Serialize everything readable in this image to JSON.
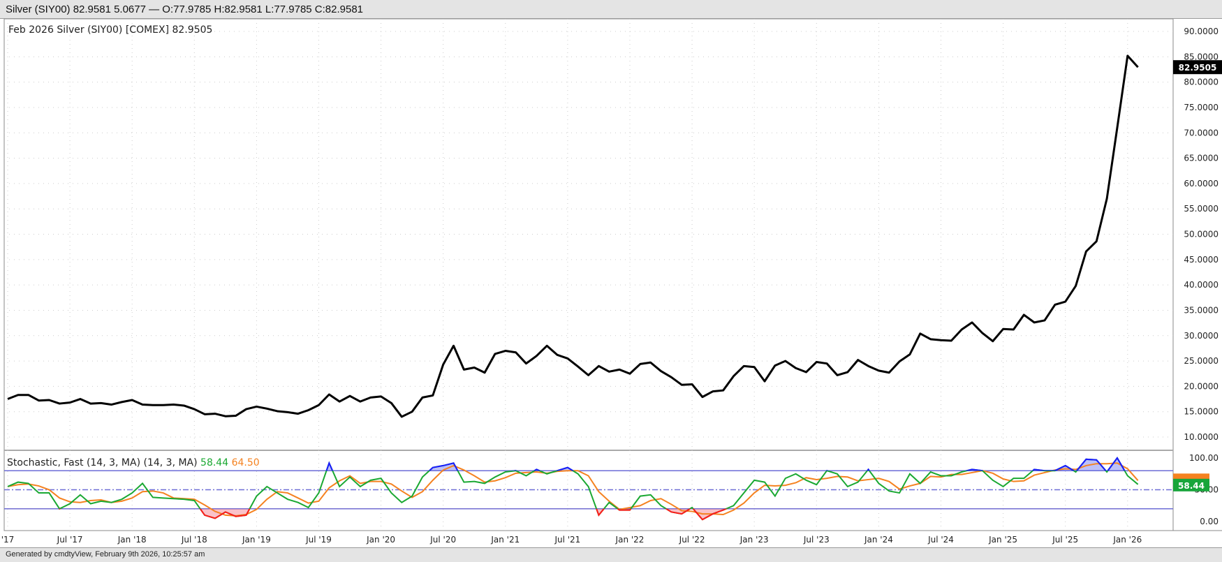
{
  "header": {
    "quote_line": "Silver (SIY00) 82.9581 5.0677 — O:77.9785 H:82.9581 L:77.9785 C:82.9581"
  },
  "footer": {
    "generated": "Generated by cmdtyView, February 9th 2026, 10:25:57 am"
  },
  "colors": {
    "price": "#000000",
    "k": "#1aa832",
    "d": "#f58220",
    "overbought": "#1a1aff",
    "oversold": "#ff1a1a",
    "band": "#6d6dd6"
  },
  "chart_data": [
    {
      "type": "line",
      "title": "Feb 2026 Silver (SIY00) [COMEX] 82.9505",
      "last_value_label": "82.9505",
      "x_start": "Jan 2017",
      "x_interval": "month",
      "xtick_labels": [
        "'17",
        "Jul '17",
        "Jan '18",
        "Jul '18",
        "Jan '19",
        "Jul '19",
        "Jan '20",
        "Jul '20",
        "Jan '21",
        "Jul '21",
        "Jan '22",
        "Jul '22",
        "Jan '23",
        "Jul '23",
        "Jan '24",
        "Jul '24",
        "Jan '25",
        "Jul '25",
        "Jan '26"
      ],
      "ytick_labels": [
        "90.0000",
        "85.0000",
        "80.0000",
        "75.0000",
        "70.0000",
        "65.0000",
        "60.0000",
        "55.0000",
        "50.0000",
        "45.0000",
        "40.0000",
        "35.0000",
        "30.0000",
        "25.0000",
        "20.0000",
        "15.0000",
        "10.0000"
      ],
      "ylim": [
        10,
        90
      ],
      "grid": true,
      "values": [
        17.5,
        18.3,
        18.3,
        17.2,
        17.3,
        16.6,
        16.8,
        17.5,
        16.6,
        16.7,
        16.4,
        16.9,
        17.3,
        16.4,
        16.3,
        16.3,
        16.4,
        16.2,
        15.5,
        14.5,
        14.6,
        14.1,
        14.2,
        15.5,
        16.0,
        15.6,
        15.1,
        14.9,
        14.6,
        15.3,
        16.3,
        18.4,
        17.0,
        18.1,
        17.0,
        17.8,
        18.0,
        16.7,
        14.0,
        15.0,
        17.8,
        18.2,
        24.3,
        28.0,
        23.3,
        23.7,
        22.7,
        26.4,
        27.0,
        26.7,
        24.5,
        26.0,
        28.0,
        26.2,
        25.5,
        23.9,
        22.2,
        24.0,
        22.9,
        23.3,
        22.5,
        24.4,
        24.7,
        23.0,
        21.8,
        20.3,
        20.4,
        17.9,
        19.0,
        19.2,
        22.0,
        24.0,
        23.8,
        21.0,
        24.1,
        25.0,
        23.6,
        22.8,
        24.8,
        24.5,
        22.2,
        22.8,
        25.2,
        24.0,
        23.1,
        22.7,
        24.9,
        26.3,
        30.4,
        29.3,
        29.1,
        29.0,
        31.2,
        32.6,
        30.5,
        28.9,
        31.3,
        31.2,
        34.1,
        32.6,
        33.0,
        36.1,
        36.7,
        39.8,
        46.6,
        48.6,
        57.0,
        71.0,
        85.2,
        82.95
      ]
    },
    {
      "type": "line",
      "title": "Stochastic, Fast (14, 3, MA)  (14, 3, MA)",
      "k_label": "58.44",
      "d_label": "64.50",
      "ytick_labels": [
        "100.00",
        "50.00",
        "0.00"
      ],
      "ylim": [
        0,
        100
      ],
      "bands": [
        20,
        50,
        80
      ],
      "series": [
        {
          "name": "%K",
          "values": [
            55,
            62,
            60,
            45,
            45,
            20,
            28,
            42,
            28,
            32,
            30,
            35,
            45,
            60,
            38,
            37,
            36,
            35,
            33,
            10,
            5,
            15,
            8,
            10,
            40,
            55,
            45,
            35,
            30,
            22,
            45,
            92,
            55,
            70,
            55,
            65,
            68,
            45,
            30,
            40,
            70,
            85,
            88,
            92,
            62,
            63,
            60,
            70,
            78,
            80,
            72,
            82,
            75,
            80,
            85,
            75,
            55,
            10,
            30,
            18,
            18,
            40,
            42,
            25,
            15,
            12,
            22,
            3,
            12,
            18,
            25,
            45,
            65,
            62,
            40,
            68,
            75,
            65,
            58,
            80,
            75,
            55,
            62,
            82,
            60,
            48,
            45,
            75,
            60,
            78,
            72,
            72,
            78,
            82,
            80,
            65,
            55,
            68,
            68,
            82,
            80,
            80,
            88,
            78,
            98,
            97,
            78,
            100,
            72,
            58.44
          ]
        },
        {
          "name": "%D",
          "values": [
            55,
            58,
            59,
            56,
            50,
            37,
            31,
            30,
            33,
            34,
            30,
            32,
            37,
            47,
            48,
            45,
            37,
            36,
            35,
            26,
            16,
            10,
            9,
            11,
            19,
            35,
            47,
            45,
            37,
            29,
            32,
            53,
            64,
            72,
            60,
            63,
            63,
            59,
            48,
            38,
            47,
            65,
            81,
            88,
            81,
            72,
            62,
            64,
            69,
            76,
            77,
            78,
            76,
            79,
            80,
            80,
            72,
            47,
            32,
            19,
            22,
            25,
            33,
            36,
            27,
            17,
            16,
            12,
            12,
            11,
            18,
            29,
            45,
            57,
            56,
            57,
            61,
            69,
            66,
            68,
            71,
            70,
            64,
            66,
            68,
            63,
            51,
            56,
            60,
            71,
            70,
            74,
            74,
            77,
            80,
            76,
            67,
            63,
            64,
            73,
            77,
            81,
            83,
            82,
            88,
            91,
            91,
            92,
            83,
            64.5
          ]
        }
      ]
    }
  ]
}
